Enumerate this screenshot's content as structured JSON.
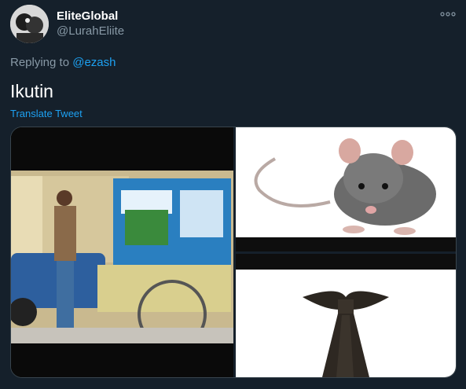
{
  "author": {
    "display_name": "EliteGlobal",
    "handle": "@LurahEliite"
  },
  "reply": {
    "prefix": "Replying to ",
    "mention": "@ezash"
  },
  "tweet": {
    "text": "Ikutin",
    "translate_label": "Translate Tweet"
  },
  "icons": {
    "more": "more-options-icon"
  },
  "colors": {
    "background": "#15202b",
    "secondary_text": "#8899a6",
    "link": "#1da1f2"
  },
  "media": {
    "images": [
      "street-food-cart-photo",
      "rat-photo",
      "necktie-photo"
    ]
  }
}
